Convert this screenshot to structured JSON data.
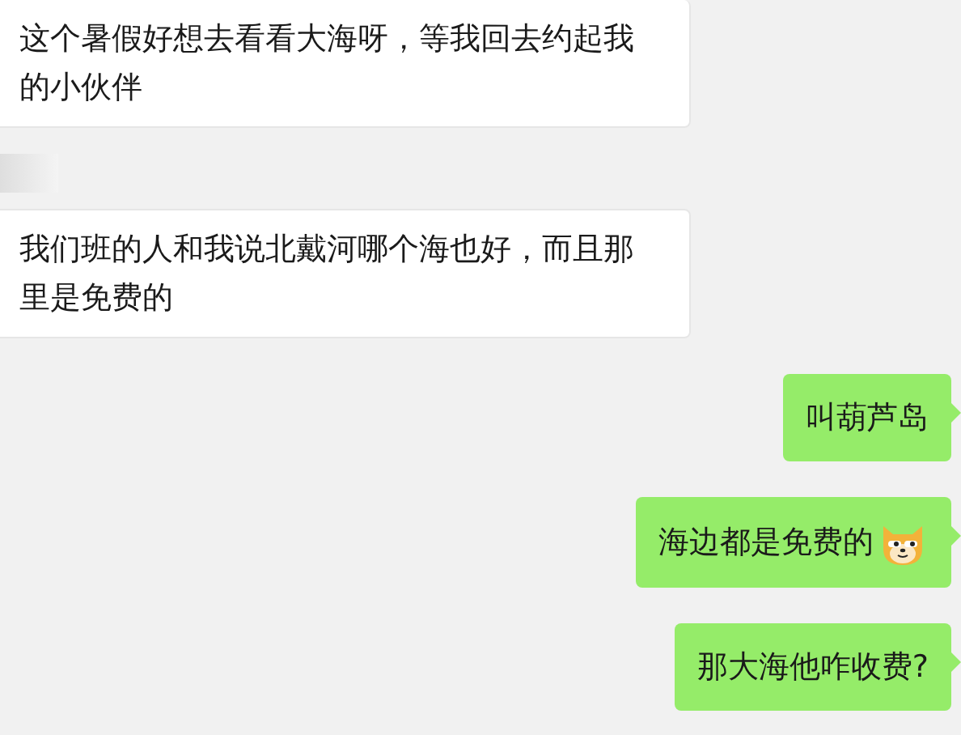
{
  "messages": [
    {
      "kind": "received",
      "text": "这个暑假好想去看看大海呀，等我回去约起我的小伙伴"
    },
    {
      "kind": "received",
      "text": "我们班的人和我说北戴河哪个海也好，而且那里是免费的"
    },
    {
      "kind": "sent",
      "text": "叫葫芦岛"
    },
    {
      "kind": "sent",
      "text": "海边都是免费的",
      "emoji": true
    },
    {
      "kind": "sent",
      "text": "那大海他咋收费?"
    }
  ]
}
